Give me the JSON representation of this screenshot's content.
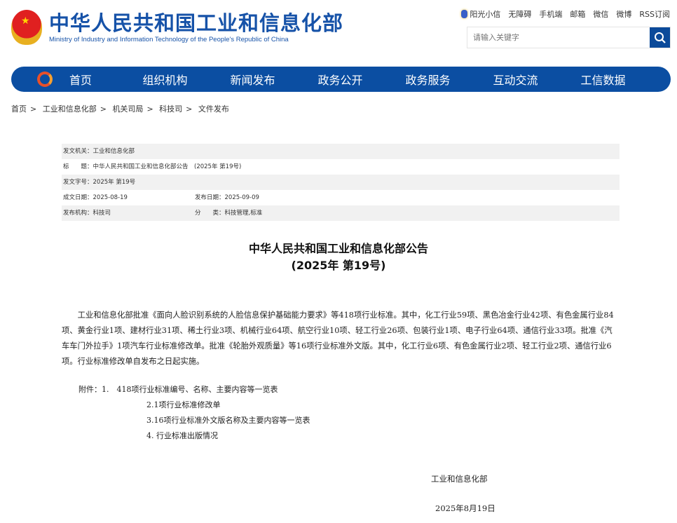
{
  "header": {
    "title_cn": "中华人民共和国工业和信息化部",
    "title_en": "Ministry of Industry and Information Technology of the People's Republic of China",
    "links": [
      "阳光小信",
      "无障碍",
      "手机端",
      "邮箱",
      "微信",
      "微博",
      "RSS订阅"
    ],
    "search_placeholder": "请输入关键字"
  },
  "nav": [
    "首页",
    "组织机构",
    "新闻发布",
    "政务公开",
    "政务服务",
    "互动交流",
    "工信数据"
  ],
  "breadcrumb": [
    "首页",
    "工业和信息化部",
    "机关司局",
    "科技司",
    "文件发布"
  ],
  "meta": {
    "issuer_label": "发文机关：",
    "issuer": "工业和信息化部",
    "title_label": "标　　题：",
    "title": "中华人民共和国工业和信息化部公告　(2025年 第19号)",
    "docno_label": "发文字号：",
    "docno": "2025年 第19号",
    "written_label": "成文日期：",
    "written": "2025-08-19",
    "published_label": "发布日期：",
    "published": "2025-09-09",
    "org_label": "发布机构：",
    "org": "科技司",
    "category_label": "分　　类：",
    "category": "科技管理,标准"
  },
  "doc": {
    "title1": "中华人民共和国工业和信息化部公告",
    "title2": "(2025年 第19号)",
    "body": "工业和信息化部批准《面向人脸识别系统的人脸信息保护基础能力要求》等418项行业标准。其中，化工行业59项、黑色冶金行业42项、有色金属行业84项、黄金行业1项、建材行业31项、稀土行业3项、机械行业64项、航空行业10项、轻工行业26项、包装行业1项、电子行业64项、通信行业33项。批准《汽车车门外拉手》1项汽车行业标准修改单。批准《轮胎外观质量》等16项行业标准外文版。其中，化工行业6项、有色金属行业2项、轻工行业2项、通信行业6项。行业标准修改单自发布之日起实施。",
    "attachments_label": "附件：1.　418项行业标准编号、名称、主要内容等一览表",
    "attachments": [
      "2.1项行业标准修改单",
      "3.16项行业标准外文版名称及主要内容等一览表",
      "4. 行业标准出版情况"
    ],
    "signer": "工业和信息化部",
    "date": "2025年8月19日"
  }
}
